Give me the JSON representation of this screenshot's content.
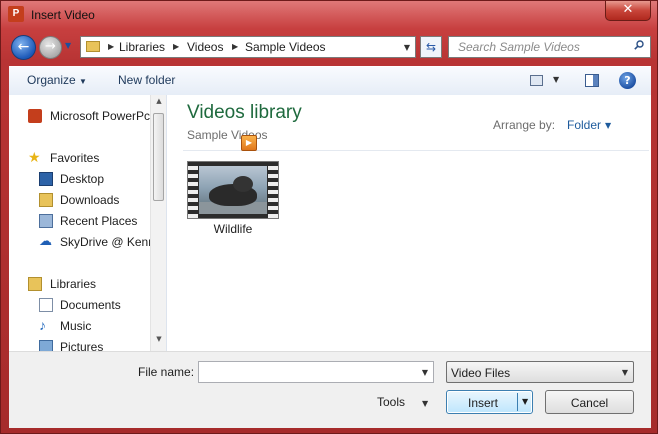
{
  "window": {
    "title": "Insert Video",
    "close_label": "✕",
    "app_icon_text": "P"
  },
  "address": {
    "crumbs": [
      "Libraries",
      "Videos",
      "Sample Videos"
    ]
  },
  "search": {
    "placeholder": "Search Sample Videos"
  },
  "toolbar": {
    "organize_label": "Organize",
    "new_folder_label": "New folder"
  },
  "nav": {
    "items": [
      {
        "label": "Microsoft PowerPc",
        "icon": "powerpoint-icon"
      },
      {
        "label": "Favorites",
        "icon": "star-icon"
      },
      {
        "label": "Desktop",
        "icon": "desktop-icon"
      },
      {
        "label": "Downloads",
        "icon": "downloads-icon"
      },
      {
        "label": "Recent Places",
        "icon": "recent-places-icon"
      },
      {
        "label": "SkyDrive @ Kenn",
        "icon": "skydrive-icon"
      },
      {
        "label": "Libraries",
        "icon": "libraries-icon"
      },
      {
        "label": "Documents",
        "icon": "documents-icon"
      },
      {
        "label": "Music",
        "icon": "music-icon"
      },
      {
        "label": "Pictures",
        "icon": "pictures-icon"
      }
    ]
  },
  "library": {
    "title": "Videos library",
    "subtitle": "Sample Videos",
    "arrange_label": "Arrange by:",
    "arrange_value": "Folder"
  },
  "files": [
    {
      "name": "Wildlife",
      "type": "video"
    }
  ],
  "bottom": {
    "file_name_label": "File name:",
    "file_name_value": "",
    "file_type_value": "Video Files",
    "tools_label": "Tools",
    "insert_label": "Insert",
    "cancel_label": "Cancel"
  },
  "colors": {
    "frame": "#c73f3f",
    "library_title": "#1f6a3e",
    "link": "#1e5b9c"
  }
}
